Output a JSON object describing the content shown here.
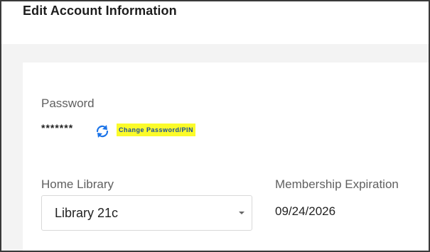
{
  "header": {
    "title": "Edit Account Information"
  },
  "password": {
    "label": "Password",
    "value": "*******",
    "refresh_icon": "refresh-icon",
    "change_link": "Change Password/PIN",
    "highlight_color": "#fbfb2a",
    "link_color": "#1b4d9b"
  },
  "home_library": {
    "label": "Home Library",
    "selected": "Library 21c"
  },
  "membership": {
    "label": "Membership Expiration",
    "value": "09/24/2026"
  }
}
